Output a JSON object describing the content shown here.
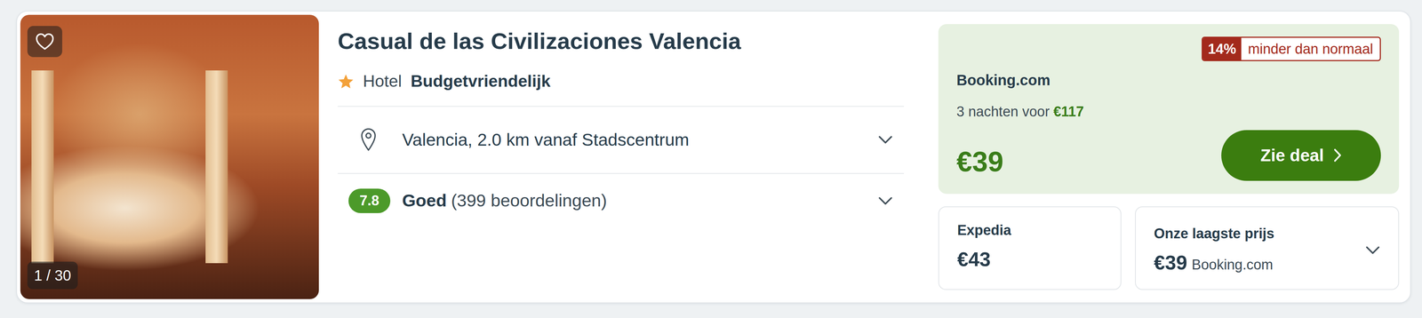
{
  "listing": {
    "name": "Casual de las Civilizaciones Valencia",
    "photo_counter": "1 / 30",
    "favorite": false,
    "stars": 1,
    "type": "Hotel",
    "tag": "Budgetvriendelijk",
    "location": {
      "text": "Valencia, 2.0 km vanaf Stadscentrum",
      "expanded": false
    },
    "rating": {
      "score": "7.8",
      "label": "Goed",
      "count": "(399 beoordelingen)",
      "expanded": false
    }
  },
  "deal": {
    "discount": "14%",
    "discount_text": "minder dan normaal",
    "provider": "Booking.com",
    "nights": "3 nachten voor",
    "total": "€117",
    "price": "€39",
    "button": "Zie deal"
  },
  "other_offers": [
    {
      "provider": "Expedia",
      "price": "€43"
    }
  ],
  "lowest": {
    "label": "Onze laagste prijs",
    "price": "€39",
    "provider": "Booking.com",
    "expanded": false
  }
}
